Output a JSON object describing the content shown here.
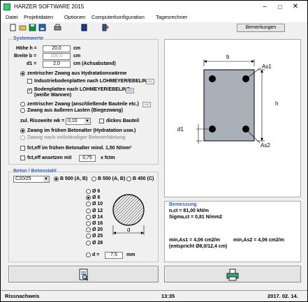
{
  "window": {
    "title": "HARZER SOFTWARE 2015",
    "minimize": "–",
    "maximize": "□",
    "close": "✕"
  },
  "menu": [
    "Datei",
    "Projektdaten",
    "Optionen",
    "Computerkonfiguration",
    "Tagesrechner"
  ],
  "toolbar": {
    "icons": [
      "new-file-icon",
      "open-folder-icon",
      "save-icon",
      "save-as-icon",
      "print-icon",
      "book-icon",
      "exit-icon"
    ],
    "bemerkungen_label": "Bemerkungen"
  },
  "systemwerte": {
    "title": "Systemwerte",
    "hoehe_label": "Höhe h =",
    "hoehe_value": "20,0",
    "hoehe_unit": "cm",
    "breite_label": "Breite b =",
    "breite_value": "100,0",
    "breite_unit": "cm",
    "d1_label": "d1 =",
    "d1_value": "2,0",
    "d1_unit": "cm (Achsabstand)",
    "opt_hydratation": "zentrischer Zwang aus Hydratationswärme",
    "opt_industrie": "Industriebodenplatten nach LOHMEYER/EBELING",
    "opt_bodenplatten": "Bodenplatten nach LOHMEYER/EBELING",
    "opt_bodenplatten2": "(weiße Wannen)",
    "opt_anschliessend": "zentrischer Zwang (anschließende Bauteile etc.)",
    "opt_biegezwang": "Zwang aus äußeren Lasten (Biegezwang)",
    "rissweite_label": "zul. Rissweite wk =",
    "rissweite_value": "0,10",
    "dickes_bauteil": "dickes Bauteil",
    "opt_frueh": "Zwang im frühen Betonalter (Hydratation usw.)",
    "opt_spaet": "Zwang nach vollständiger Betonerhärtung",
    "fct_frueh": "fct,eff im frühen Betonalter mind. 1,50 N/mm²",
    "fct_ansetzen": "fct,eff ansetzen mit",
    "fct_value": "0,75",
    "fct_unit": "x fctm"
  },
  "beton": {
    "title": "Beton / Betonstahl",
    "concrete_class": "C20/25",
    "steel_options": [
      "B 500 (A, B)",
      "B 550 (A, B)",
      "B 450 (C)"
    ],
    "diameters": [
      "Ø 6",
      "Ø 8",
      "Ø 10",
      "Ø 12",
      "Ø 14",
      "Ø 16",
      "Ø 20",
      "Ø 25",
      "Ø 28"
    ],
    "selected_diameter_index": 1,
    "d_label": "d =",
    "d_value": "7,5",
    "d_unit": "mm",
    "section_label": "d"
  },
  "diagram": {
    "b_label": "b",
    "h_label": "h",
    "d1_label": "d1",
    "as1_label": "As1",
    "as2_label": "As2"
  },
  "bemessung": {
    "title": "Bemessung",
    "line1": "n,ct = 81,00 kN/m",
    "line2": "Sigma,ct = 0,81 N/mm2",
    "line3a": "min,As1 = 4,06 cm2/m",
    "line3b": "min,As2 = 4,06 cm2/m",
    "line4": "(entspricht Ø8,0/12,4 cm)"
  },
  "statusbar": {
    "name": "Rissnachweis",
    "time": "13:35",
    "date": "2017. 02. 14."
  }
}
